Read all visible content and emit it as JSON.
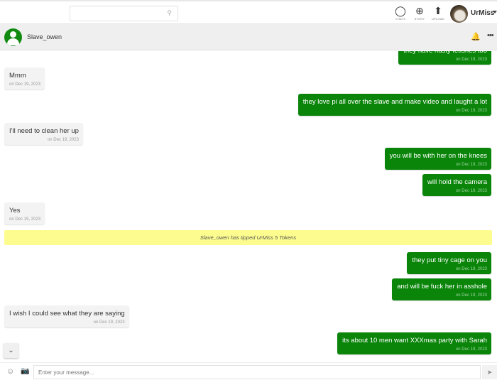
{
  "topbar": {
    "search_placeholder": "",
    "search_icon": "search-icon",
    "nav": [
      {
        "label": "CHATS",
        "icon": "chat-bubble-icon",
        "glyph": "◯"
      },
      {
        "label": "STORY",
        "icon": "add-story-icon",
        "glyph": "⊕"
      },
      {
        "label": "UPLOAD",
        "icon": "upload-icon",
        "glyph": "⬆"
      }
    ],
    "user_name": "UrMiss"
  },
  "chat_header": {
    "contact_name": "Slave_owen",
    "bell_glyph": "🔔",
    "more_glyph": "•••"
  },
  "messages": [
    {
      "dir": "out",
      "text": "they have nasty fetishes too",
      "time": "on Dec 19, 2023"
    },
    {
      "dir": "in",
      "text": "Mmm",
      "time": "on Dec 19, 2023"
    },
    {
      "dir": "out",
      "text": "they love pi all over the slave and make video and laught a lot",
      "time": "on Dec 19, 2023"
    },
    {
      "dir": "in",
      "text": "I'll need to clean her up",
      "time": "on Dec 19, 2023"
    },
    {
      "dir": "out",
      "text": "you will be with her on the knees",
      "time": "on Dec 19, 2023"
    },
    {
      "dir": "out",
      "text": "will hold the camera",
      "time": "on Dec 19, 2023"
    },
    {
      "dir": "in",
      "text": "Yes",
      "time": "on Dec 19, 2023"
    },
    {
      "dir": "out",
      "text": "they put tiny cage on you",
      "time": "on Dec 19, 2023"
    },
    {
      "dir": "out",
      "text": "and will be fuck her in asshole",
      "time": "on Dec 19, 2023"
    },
    {
      "dir": "in",
      "text": "I wish I could see what they are saying",
      "time": "on Dec 19, 2023"
    },
    {
      "dir": "out",
      "text": "its about 10 men want XXXmas party with Sarah",
      "time": "on Dec 19, 2023"
    }
  ],
  "tip_notice": "Slave_owen has tipped UrMiss 5 Tokens",
  "composer": {
    "placeholder": "Enter your message...",
    "value": "",
    "emoji_glyph": "☺",
    "camera_glyph": "📷",
    "send_glyph": "➤",
    "scroll_down_glyph": "⌄"
  },
  "colors": {
    "outgoing_bubble": "#0a850a",
    "incoming_bubble": "#f3f3f3",
    "tip_banner": "#fdfd8f",
    "avatar_green": "#118a11"
  }
}
